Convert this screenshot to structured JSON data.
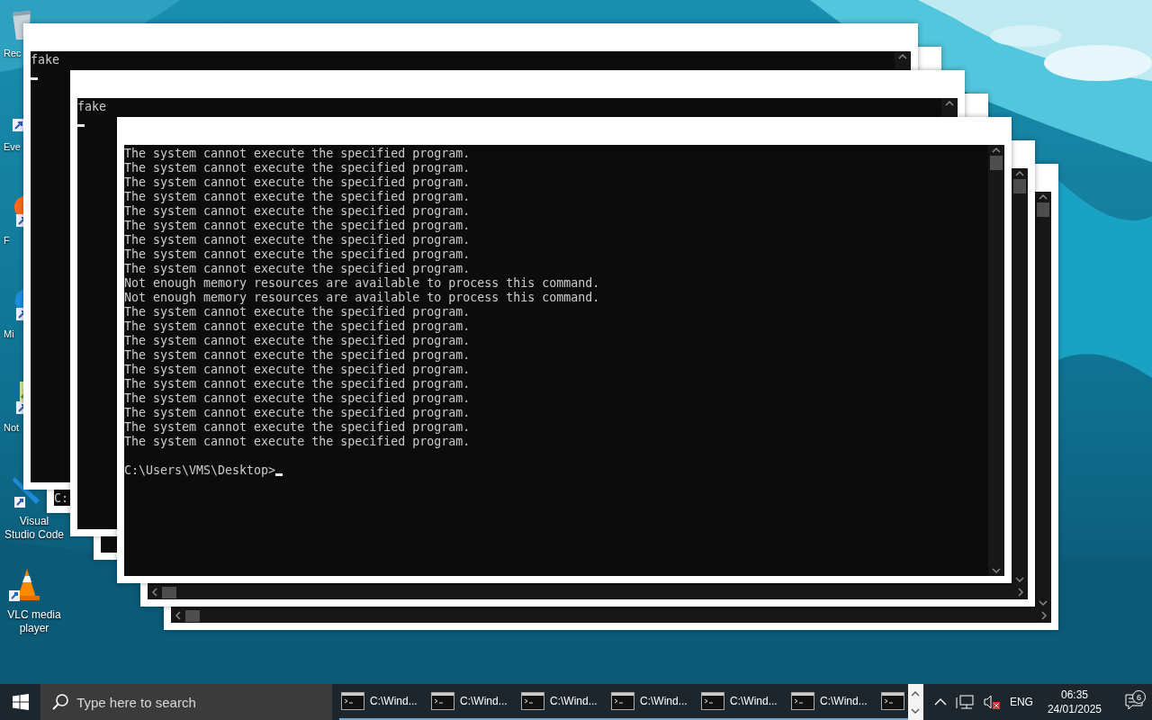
{
  "desktop_icons": [
    {
      "kind": "bin",
      "label": "Rec"
    },
    {
      "kind": "app",
      "label": "Eve"
    },
    {
      "kind": "browser",
      "label": "F"
    },
    {
      "kind": "globe",
      "label": "Mi"
    },
    {
      "kind": "notepad",
      "label": "Not"
    },
    {
      "kind": "editor",
      "label": "Visual Studio Code"
    },
    {
      "kind": "cone",
      "label": "VLC media player"
    }
  ],
  "windows": [
    {
      "kind": "console",
      "lines": [
        "fake"
      ],
      "cursor": true
    },
    {
      "kind": "console",
      "lines": [
        "C:"
      ],
      "scrolled_to_end": true
    },
    {
      "kind": "console",
      "lines": [
        "fake"
      ],
      "cursor": true
    },
    {
      "kind": "console"
    },
    {
      "kind": "console",
      "lines": [
        "The system cannot execute the specified program.",
        "The system cannot execute the specified program.",
        "The system cannot execute the specified program.",
        "The system cannot execute the specified program.",
        "The system cannot execute the specified program.",
        "The system cannot execute the specified program.",
        "The system cannot execute the specified program.",
        "The system cannot execute the specified program.",
        "The system cannot execute the specified program.",
        "Not enough memory resources are available to process this command.",
        "Not enough memory resources are available to process this command.",
        "The system cannot execute the specified program.",
        "The system cannot execute the specified program.",
        "The system cannot execute the specified program.",
        "The system cannot execute the specified program.",
        "The system cannot execute the specified program.",
        "The system cannot execute the specified program.",
        "The system cannot execute the specified program.",
        "The system cannot execute the specified program.",
        "The system cannot execute the specified program.",
        "The system cannot execute the specified program."
      ],
      "prompt": "C:\\Users\\VMS\\Desktop>",
      "cursor": true
    },
    {
      "kind": "console",
      "horizontal_scrollbar": true
    },
    {
      "kind": "console",
      "horizontal_scrollbar": true
    }
  ],
  "taskbar": {
    "search": {
      "placeholder": "Type here to search"
    },
    "tasks": [
      {
        "kind": "labeled",
        "label": "C:\\Wind..."
      },
      {
        "kind": "labeled",
        "label": "C:\\Wind..."
      },
      {
        "kind": "labeled",
        "label": "C:\\Wind..."
      },
      {
        "kind": "labeled",
        "label": "C:\\Wind..."
      },
      {
        "kind": "labeled",
        "label": "C:\\Wind..."
      },
      {
        "kind": "labeled",
        "label": "C:\\Wind..."
      },
      {
        "kind": "icon"
      }
    ],
    "volume": {
      "muted": true
    },
    "language": "ENG",
    "time": "06:35",
    "date": "24/01/2025",
    "notifications": "6"
  }
}
